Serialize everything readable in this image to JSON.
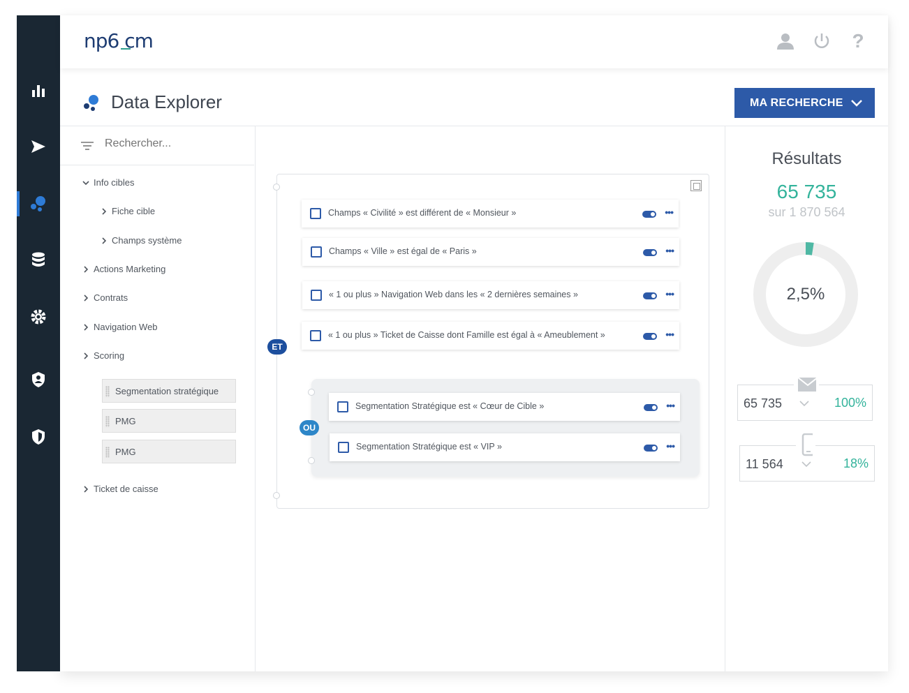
{
  "app": {
    "logo": "np6 cm"
  },
  "header": {
    "page_title": "Data Explorer",
    "search_button": "MA RECHERCHE"
  },
  "tree": {
    "search_placeholder": "Rechercher...",
    "nodes": [
      {
        "label": "Info cibles",
        "expanded": true
      },
      {
        "label": "Fiche cible"
      },
      {
        "label": "Champs système"
      },
      {
        "label": "Actions Marketing"
      },
      {
        "label": "Contrats"
      },
      {
        "label": "Navigation Web"
      },
      {
        "label": "Scoring"
      },
      {
        "label": "Ticket de caisse"
      }
    ],
    "chips": [
      "Segmentation stratégique",
      "PMG",
      "PMG"
    ]
  },
  "canvas": {
    "operator_and": "ET",
    "operator_or": "OU",
    "conditions": [
      "Champs « Civilité » est différent de « Monsieur »",
      "Champs « Ville » est égal de « Paris »",
      "« 1 ou plus » Navigation Web dans les « 2 dernières semaines »",
      "« 1 ou plus » Ticket de Caisse dont Famille est égal à « Ameublement »"
    ],
    "or_conditions": [
      "Segmentation Stratégique est  « Cœur de Cible »",
      "Segmentation Stratégique est « VIP »"
    ]
  },
  "results": {
    "title": "Résultats",
    "count": "65 735",
    "total": "sur 1 870 564",
    "percent_label": "2,5%",
    "percent_value": 0.025,
    "email": {
      "value": "65 735",
      "percent": "100%"
    },
    "mobile": {
      "value": "11 564",
      "percent": "18%"
    }
  },
  "colors": {
    "brand": "#2d5aa8",
    "accent": "#33b39b",
    "rail": "#1a2733"
  }
}
